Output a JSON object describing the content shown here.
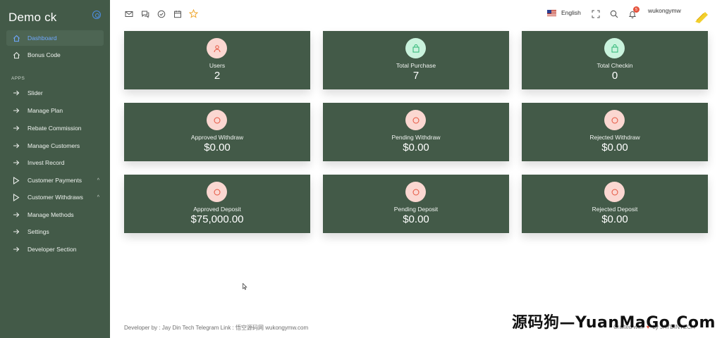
{
  "sidebar": {
    "brand": "Demo ck",
    "section_label": "APPS",
    "top_items": [
      {
        "label": "Dashboard",
        "icon": "home-icon"
      },
      {
        "label": "Bonus Code",
        "icon": "home-icon"
      }
    ],
    "app_items": [
      {
        "label": "Slider",
        "icon": "arrow-right-icon"
      },
      {
        "label": "Manage Plan",
        "icon": "arrow-right-icon"
      },
      {
        "label": "Rebate Commission",
        "icon": "arrow-right-icon"
      },
      {
        "label": "Manage Customers",
        "icon": "arrow-right-icon"
      },
      {
        "label": "Invest Record",
        "icon": "arrow-right-icon"
      },
      {
        "label": "Customer Payments",
        "icon": "play-icon",
        "chevron": "^"
      },
      {
        "label": "Customer Withdraws",
        "icon": "play-icon",
        "chevron": "^"
      },
      {
        "label": "Manage Methods",
        "icon": "arrow-right-icon"
      },
      {
        "label": "Settings",
        "icon": "arrow-right-icon"
      },
      {
        "label": "Developer Section",
        "icon": "arrow-right-icon"
      }
    ]
  },
  "topbar": {
    "language": "English",
    "notification_count": "5",
    "username": "wukongymw"
  },
  "cards": [
    {
      "label": "Users",
      "value": "2",
      "icon": "user-icon"
    },
    {
      "label": "Total Purchase",
      "value": "7",
      "icon": "shopping-bag-icon"
    },
    {
      "label": "Total Checkin",
      "value": "0",
      "icon": "shopping-bag-icon"
    },
    {
      "label": "Approved Withdraw",
      "value": "$0.00",
      "icon": "circle-icon"
    },
    {
      "label": "Pending Withdraw",
      "value": "$0.00",
      "icon": "circle-icon"
    },
    {
      "label": "Rejected Withdraw",
      "value": "$0.00",
      "icon": "circle-icon"
    },
    {
      "label": "Approved Deposit",
      "value": "$75,000.00",
      "icon": "circle-icon"
    },
    {
      "label": "Pending Deposit",
      "value": "$0.00",
      "icon": "circle-icon"
    },
    {
      "label": "Rejected Deposit",
      "value": "$0.00",
      "icon": "circle-icon"
    }
  ],
  "footer": {
    "left": "Developer by : Jay Din Tech Telegram Link : 悟空源码网 wukongymw.com",
    "crafted": "Crafted with",
    "by": "by JAYDINTECH"
  },
  "watermark": "源码狗—YuanMaGo.Com",
  "colors": {
    "sidebar_bg": "#435a48",
    "card_bg": "#435a48",
    "active_text": "#6fa8ff",
    "icon_pink_bg": "#fbd7d1",
    "icon_green_bg": "#c9f3dd",
    "star": "#f0a830"
  }
}
